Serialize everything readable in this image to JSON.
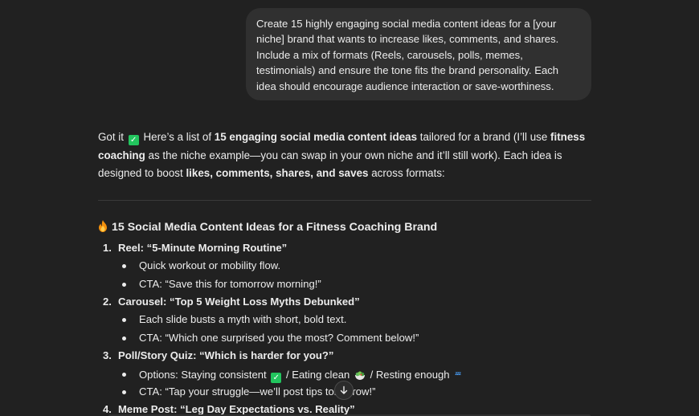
{
  "user_message": {
    "text": "Create 15 highly engaging social media content ideas for a [your niche] brand that wants to increase likes, comments, and shares. Include a mix of formats (Reels, carousels, polls, memes, testimonials) and ensure the tone fits the brand personality. Each idea should encourage audience interaction or save-worthiness."
  },
  "response": {
    "intro": {
      "p1": "Got it",
      "p2": " Here’s a list of ",
      "b1": "15 engaging social media content ideas",
      "p3": " tailored for a brand (I’ll use ",
      "b2": "fitness coaching",
      "p4": " as the niche example—you can swap in your own niche and it’ll still work). Each idea is designed to boost ",
      "b3": "likes, comments, shares, and saves",
      "p5": " across formats:"
    },
    "heading": "15 Social Media Content Ideas for a Fitness Coaching Brand",
    "items": [
      {
        "number": "1.",
        "title": "Reel: “5-Minute Morning Routine”",
        "sub": [
          "Quick workout or mobility flow.",
          "CTA: “Save this for tomorrow morning!”"
        ]
      },
      {
        "number": "2.",
        "title": "Carousel: “Top 5 Weight Loss Myths Debunked”",
        "sub": [
          "Each slide busts a myth with short, bold text.",
          "CTA: “Which one surprised you the most? Comment below!”"
        ]
      },
      {
        "number": "3.",
        "title": "Poll/Story Quiz: “Which is harder for you?”",
        "options_parts": [
          "Options: Staying consistent",
          " / Eating clean",
          " / Resting enough"
        ],
        "cta": "CTA: “Tap your struggle—we’ll post tips tomorrow!”"
      },
      {
        "number": "4.",
        "title": "Meme Post: “Leg Day Expectations vs. Reality”"
      }
    ]
  },
  "icons": {
    "check": "check-mark-button-emoji",
    "fire": "fire-emoji",
    "salad": "green-salad-emoji",
    "sleep": "zzz-emoji",
    "scroll": "arrow-down-icon"
  },
  "colors": {
    "background": "#212121",
    "bubble": "#303030",
    "text": "#ececec",
    "check": "#22c55e",
    "zzz": "#4aa3ff"
  }
}
